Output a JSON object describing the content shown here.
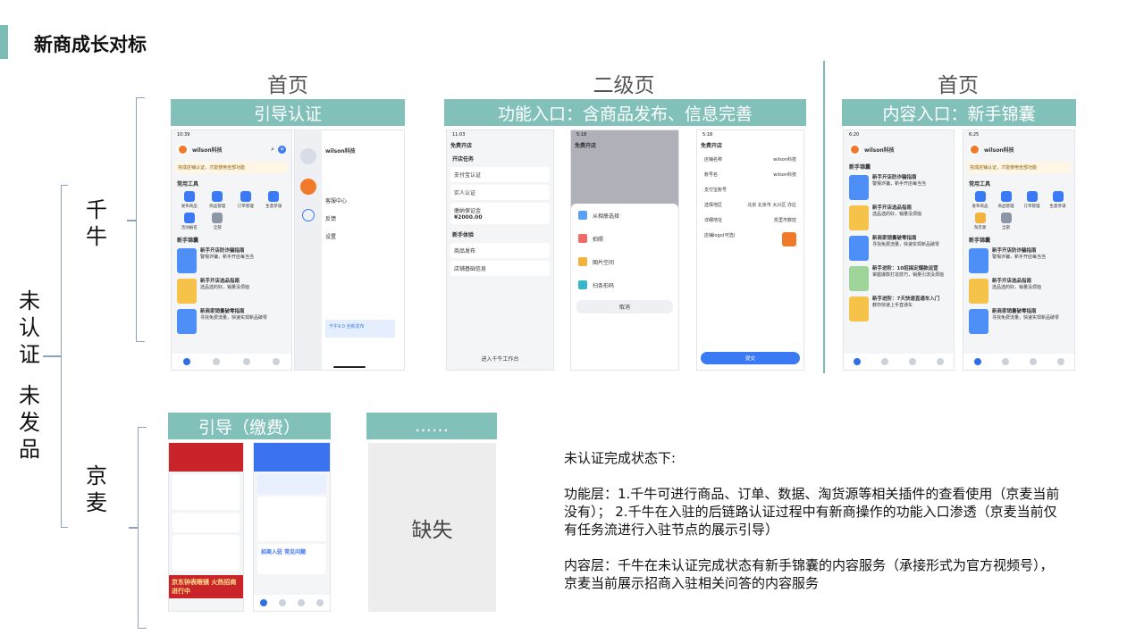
{
  "slide_title": "新商成长对标",
  "columns": {
    "col1_head": "首页",
    "col2_head": "二级页",
    "col3_head": "首页"
  },
  "labels": {
    "guide_auth": "引导认证",
    "function_entry": "功能入口：含商品发布、信息完善",
    "content_entry": "内容入口：新手锦囊",
    "guide_pay": "引导（缴费）",
    "ellipsis": "……"
  },
  "left_label": [
    "未",
    "认",
    "证",
    "",
    "未",
    "发",
    "品"
  ],
  "row_labels": {
    "qianniu": [
      "千",
      "牛"
    ],
    "jingmai": [
      "京",
      "麦"
    ]
  },
  "missing_text": "缺失",
  "notes": {
    "intro": "未认证完成状态下:",
    "function_layer": "功能层：1.千牛可进行商品、订单、数据、淘货源等相关插件的查看使用（京麦当前没有）； 2.千牛在入驻的后链路认证过程中有新商操作的功能入口渗透（京麦当前仅有任务流进行入驻节点的展示引导）",
    "content_layer": "内容层：千牛在未认证完成状态有新手锦囊的内容服务（承接形式为官方视频号），京麦当前展示招商入驻相关问答的内容服务"
  },
  "screens": {
    "qn_home": {
      "time": "10:39",
      "shop": "wilson科技",
      "warn": "完成店铺认证，才能使用全部功能",
      "tools_title": "常用工具",
      "tools": [
        "发布商品",
        "商品管理",
        "订单管理",
        "生意参谋",
        "活动报名",
        "全部"
      ],
      "guide_title": "新手锦囊",
      "guides": [
        {
          "title": "新手开店防诈骗指南",
          "desc": "警惕诈骗，新手开店每当当"
        },
        {
          "title": "新手开店选品指南",
          "desc": "选品选的好，销量没烦恼"
        },
        {
          "title": "新商家销量破零指南",
          "desc": "寻找免费流量，快速实现新品破零"
        }
      ]
    },
    "qn_menu": {
      "time": "4:37",
      "shop": "wilson科技",
      "items": [
        "客服中心",
        "反馈",
        "设置"
      ],
      "banner": "千牛9.0 全新发布"
    },
    "open_shop": {
      "time": "11:03",
      "title": "免费开店",
      "tasks_title": "开店任务",
      "tasks": [
        "支付宝认证",
        "实人认证",
        "缴纳保证金"
      ],
      "deposit": "¥2000.00",
      "newbie_title": "新手体验",
      "newbie": [
        "商品发布",
        "店铺基础信息"
      ],
      "enter": "进入千牛工作台"
    },
    "open_shop_sheet": {
      "time": "5:18",
      "title": "免费开店",
      "options": [
        "从相册选择",
        "拍照",
        "图片空间",
        "扫条形码"
      ],
      "cancel": "取消"
    },
    "shop_form": {
      "time": "5:18",
      "title": "免费开店",
      "fields": [
        {
          "label": "店铺名称",
          "value": "wilson科技"
        },
        {
          "label": "账号名",
          "value": "wilson科技"
        },
        {
          "label": "支付宝账号",
          "value": ""
        },
        {
          "label": "选择地区",
          "value": "北京 北京市 大兴区 亦庄"
        },
        {
          "label": "详细地址",
          "value": "凯里市数控"
        },
        {
          "label": "店铺logo(可选)",
          "value": ""
        }
      ],
      "submit": "提交"
    },
    "content_a": {
      "time": "6:20",
      "shop": "wilson科技",
      "guide_title": "新手锦囊",
      "guides": [
        {
          "title": "新手开店防诈骗指南",
          "desc": "警惕诈骗，新手开店每当当"
        },
        {
          "title": "新手开店选品指南",
          "desc": "选品选的好，销量没烦恼"
        },
        {
          "title": "新商家销量破零指南",
          "desc": "寻找免费流量，快速实现新品破零"
        },
        {
          "title": "新手进阶：10招搞定爆款运营",
          "desc": "掌握爆款打造技巧，销量引流没烦恼"
        },
        {
          "title": "新手进阶：7天快速直通车入门",
          "desc": "教你快速上手直通车"
        }
      ]
    },
    "content_b": {
      "time": "6:25",
      "shop": "wilson科技",
      "warn": "完成店铺认证，才能使用全部功能",
      "tools_title": "常用工具",
      "tools": [
        "发布商品",
        "商品管理",
        "订单管理",
        "生意参谋",
        "淘货源",
        "全部"
      ],
      "guide_title": "新手锦囊",
      "guides": [
        {
          "title": "新手开店防诈骗指南",
          "desc": "警惕诈骗，新手开店每当当"
        },
        {
          "title": "新手开店选品指南",
          "desc": "选品选的好，销量没烦恼"
        },
        {
          "title": "新商家销量破零指南",
          "desc": "寻找免费流量，快速实现新品破零"
        }
      ]
    },
    "jd_a": {
      "banner": "京东钟表眼镜 火热招商进行中"
    },
    "jd_b": {
      "banner": "招商入驻 常见问题"
    }
  },
  "colors": {
    "accent": "#7bbcb4",
    "label_bg": "#82c1b9",
    "brace": "#8fa3b8"
  }
}
